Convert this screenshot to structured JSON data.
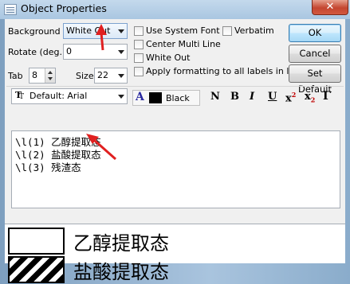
{
  "window": {
    "title": "Object Properties",
    "close_glyph": "✕"
  },
  "background": {
    "label": "Background",
    "value": "White Out"
  },
  "rotate": {
    "label": "Rotate (deg.)",
    "value": "0"
  },
  "tab": {
    "label": "Tab",
    "value": "8"
  },
  "size": {
    "label": "Size",
    "value": "22"
  },
  "options": {
    "use_system_font": "Use System Font",
    "verbatim": "Verbatim",
    "center_multi_line": "Center Multi Line",
    "white_out": "White Out",
    "apply_all": "Apply formatting to all labels in layer"
  },
  "buttons": {
    "ok": "OK",
    "cancel": "Cancel",
    "set_default": "Set Default"
  },
  "font": {
    "value": "Default: Arial",
    "tt_glyph": "T"
  },
  "color": {
    "prefix": "A",
    "value": "Black",
    "swatch": "#000000"
  },
  "format": {
    "normal": "N",
    "bold": "B",
    "italic": "I",
    "underline": "U",
    "superscript_base": "x",
    "superscript_mark": "2",
    "subscript_base": "x",
    "subscript_mark": "2",
    "greek": "Γ"
  },
  "editor_lines": [
    "\\l(1) 乙醇提取态",
    "\\l(2) 盐酸提取态",
    "\\l(3) 残渣态"
  ],
  "preview": {
    "label1": "乙醇提取态",
    "label2": "盐酸提取态"
  },
  "annotation_color": "#e02020"
}
